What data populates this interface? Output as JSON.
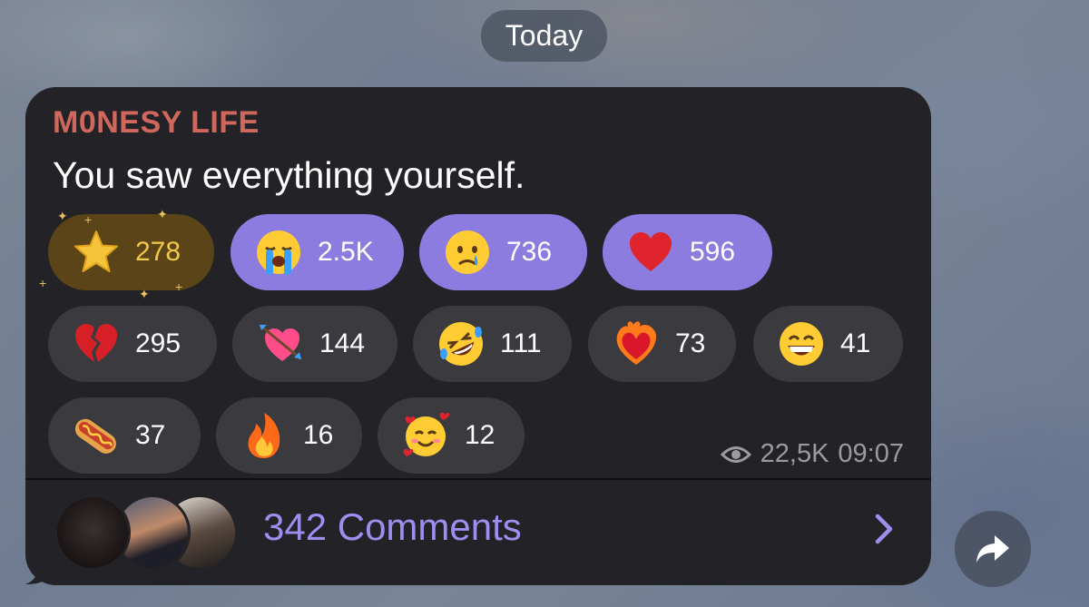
{
  "date_separator": "Today",
  "message": {
    "channel_name": "M0NESY LIFE",
    "text": "You saw everything yourself.",
    "views": "22,5K",
    "time": "09:07"
  },
  "reactions": [
    {
      "emoji": "star-icon",
      "count": "278"
    },
    {
      "emoji": "loudly-crying-face-icon",
      "count": "2.5K"
    },
    {
      "emoji": "crying-face-icon",
      "count": "736"
    },
    {
      "emoji": "red-heart-icon",
      "count": "596"
    },
    {
      "emoji": "broken-heart-icon",
      "count": "295"
    },
    {
      "emoji": "heart-with-arrow-icon",
      "count": "144"
    },
    {
      "emoji": "rolling-laughing-face-icon",
      "count": "111"
    },
    {
      "emoji": "heart-on-fire-icon",
      "count": "73"
    },
    {
      "emoji": "grinning-face-icon",
      "count": "41"
    },
    {
      "emoji": "hot-dog-icon",
      "count": "37"
    },
    {
      "emoji": "fire-icon",
      "count": "16"
    },
    {
      "emoji": "smiling-face-with-hearts-icon",
      "count": "12"
    }
  ],
  "comments": {
    "label": "342 Comments"
  },
  "colors": {
    "bubble": "#232327",
    "channel_name": "#d0675d",
    "accent": "#8d7ce0",
    "comments_link": "#9d8ff0",
    "star_reaction": "#5a4418"
  }
}
